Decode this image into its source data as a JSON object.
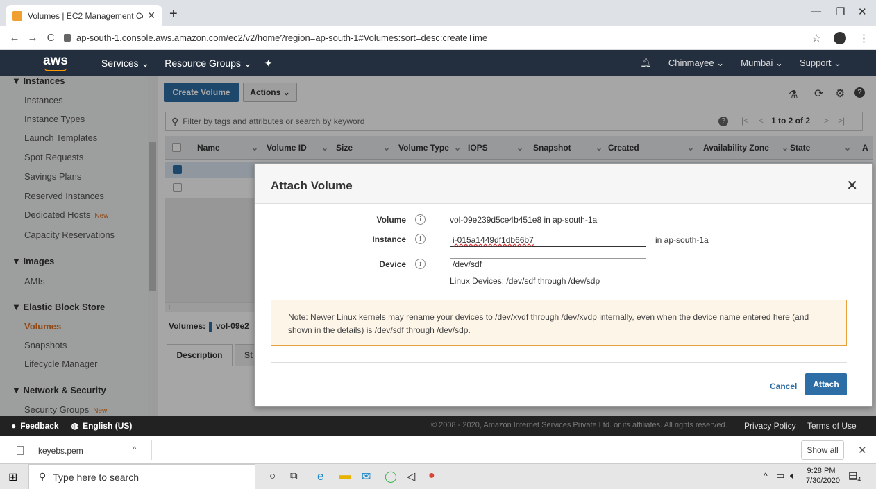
{
  "browser": {
    "tab_title": "Volumes | EC2 Management Con",
    "url": "ap-south-1.console.aws.amazon.com/ec2/v2/home?region=ap-south-1#Volumes:sort=desc:createTime"
  },
  "aws_nav": {
    "logo": "aws",
    "services": "Services",
    "resource_groups": "Resource Groups",
    "user": "Chinmayee",
    "region": "Mumbai",
    "support": "Support"
  },
  "sidebar": {
    "instances_header": "Instances",
    "instances_items": [
      "Instances",
      "Instance Types",
      "Launch Templates",
      "Spot Requests",
      "Savings Plans",
      "Reserved Instances",
      "Dedicated Hosts",
      "Capacity Reservations"
    ],
    "new_badge": "New",
    "images_header": "Images",
    "images_items": [
      "AMIs"
    ],
    "ebs_header": "Elastic Block Store",
    "ebs_items": [
      "Volumes",
      "Snapshots",
      "Lifecycle Manager"
    ],
    "network_header": "Network & Security",
    "network_items": [
      "Security Groups"
    ]
  },
  "toolbar": {
    "create_volume": "Create Volume",
    "actions": "Actions"
  },
  "filter": {
    "placeholder": "Filter by tags and attributes or search by keyword",
    "pagination": "1 to 2 of 2"
  },
  "table": {
    "columns": [
      "Name",
      "Volume ID",
      "Size",
      "Volume Type",
      "IOPS",
      "Snapshot",
      "Created",
      "Availability Zone",
      "State",
      "A"
    ]
  },
  "details": {
    "label": "Volumes:",
    "volume_short": "vol-09e2",
    "tab_description": "Description",
    "tab_status": "St"
  },
  "modal": {
    "title": "Attach Volume",
    "volume_label": "Volume",
    "volume_value": "vol-09e239d5ce4b451e8 in ap-south-1a",
    "instance_label": "Instance",
    "instance_value": "i-015a1449df1db66b7",
    "instance_suffix": "in ap-south-1a",
    "device_label": "Device",
    "device_value": "/dev/sdf",
    "device_hint": "Linux Devices: /dev/sdf through /dev/sdp",
    "note": "Note: Newer Linux kernels may rename your devices to /dev/xvdf through /dev/xvdp internally, even when the device name entered here (and shown in the details) is /dev/sdf through /dev/sdp.",
    "cancel": "Cancel",
    "attach": "Attach"
  },
  "footer": {
    "feedback": "Feedback",
    "language": "English (US)",
    "copyright": "© 2008 - 2020, Amazon Internet Services Private Ltd. or its affiliates. All rights reserved.",
    "privacy": "Privacy Policy",
    "terms": "Terms of Use"
  },
  "downloads": {
    "file": "keyebs.pem",
    "show_all": "Show all"
  },
  "taskbar": {
    "search_placeholder": "Type here to search",
    "time": "9:28 PM",
    "date": "7/30/2020",
    "notif_count": "4"
  },
  "colors": {
    "aws_nav_bg": "#232f3e",
    "aws_orange": "#ff9900",
    "primary_blue": "#2e6ea7",
    "active_orange": "#e07020"
  }
}
